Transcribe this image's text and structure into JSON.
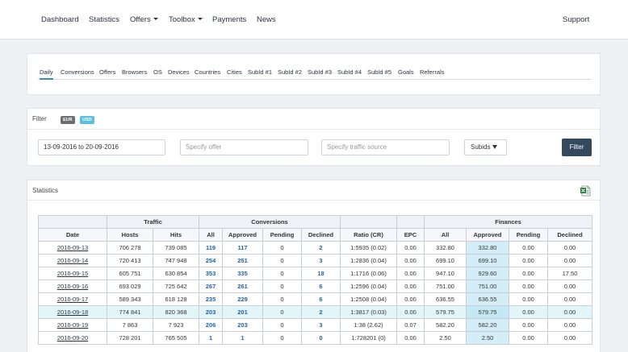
{
  "nav": {
    "items": [
      {
        "label": "Dashboard",
        "dropdown": false
      },
      {
        "label": "Statistics",
        "dropdown": false
      },
      {
        "label": "Offers",
        "dropdown": true
      },
      {
        "label": "Toolbox",
        "dropdown": true
      },
      {
        "label": "Payments",
        "dropdown": false
      },
      {
        "label": "News",
        "dropdown": false
      }
    ],
    "support": "Support"
  },
  "tabs": [
    "Daily",
    "Conversions",
    "Offers",
    "Browsers",
    "OS",
    "Devices",
    "Countries",
    "Cities",
    "SubId #1",
    "SubId #2",
    "SubId #3",
    "SubId #4",
    "SubId #5",
    "Goals",
    "Referrals"
  ],
  "active_tab": "Daily",
  "filter": {
    "title": "Filter",
    "currencies": [
      "EUR",
      "USD"
    ],
    "active_currency": "USD",
    "date_range": "13-09-2016 to 20-09-2016",
    "offer_placeholder": "Specify offer",
    "source_placeholder": "Specify traffic source",
    "subids_label": "Subids",
    "button_label": "Filter"
  },
  "stats": {
    "title": "Statistics",
    "groups": {
      "traffic": "Traffic",
      "conversions": "Conversions",
      "finances": "Finances"
    },
    "columns": [
      "Date",
      "Hosts",
      "Hits",
      "All",
      "Approved",
      "Pending",
      "Declined",
      "Ratio (CR)",
      "EPC",
      "All",
      "Approved",
      "Pending",
      "Declined"
    ],
    "rows": [
      {
        "date": "2016-09-13",
        "hosts": "706 278",
        "hits": "739 085",
        "conv_all": "119",
        "conv_approved": "117",
        "conv_pending": "0",
        "conv_declined": "2",
        "ratio": "1:5935 (0.02)",
        "epc": "0.00",
        "fin_all": "332.80",
        "fin_approved": "332.80",
        "fin_pending": "0.00",
        "fin_declined": "0.00",
        "highlight": false
      },
      {
        "date": "2016-09-14",
        "hosts": "720 413",
        "hits": "747 948",
        "conv_all": "254",
        "conv_approved": "251",
        "conv_pending": "0",
        "conv_declined": "3",
        "ratio": "1:2836 (0.04)",
        "epc": "0.00",
        "fin_all": "699.10",
        "fin_approved": "699.10",
        "fin_pending": "0.00",
        "fin_declined": "0.00",
        "highlight": false
      },
      {
        "date": "2016-09-15",
        "hosts": "605 751",
        "hits": "630 854",
        "conv_all": "353",
        "conv_approved": "335",
        "conv_pending": "0",
        "conv_declined": "18",
        "ratio": "1:1716 (0.06)",
        "epc": "0.00",
        "fin_all": "947.10",
        "fin_approved": "929.60",
        "fin_pending": "0.00",
        "fin_declined": "17.50",
        "highlight": false
      },
      {
        "date": "2016-09-16",
        "hosts": "693 029",
        "hits": "725 642",
        "conv_all": "267",
        "conv_approved": "261",
        "conv_pending": "0",
        "conv_declined": "6",
        "ratio": "1:2596 (0.04)",
        "epc": "0.00",
        "fin_all": "751.00",
        "fin_approved": "751.00",
        "fin_pending": "0.00",
        "fin_declined": "0.00",
        "highlight": false
      },
      {
        "date": "2016-09-17",
        "hosts": "589 343",
        "hits": "618 128",
        "conv_all": "235",
        "conv_approved": "229",
        "conv_pending": "0",
        "conv_declined": "6",
        "ratio": "1:2508 (0.04)",
        "epc": "0.00",
        "fin_all": "636.55",
        "fin_approved": "636.55",
        "fin_pending": "0.00",
        "fin_declined": "0.00",
        "highlight": false
      },
      {
        "date": "2016-09-18",
        "hosts": "774 841",
        "hits": "820 368",
        "conv_all": "203",
        "conv_approved": "201",
        "conv_pending": "0",
        "conv_declined": "2",
        "ratio": "1:3817 (0.03)",
        "epc": "0.00",
        "fin_all": "579.75",
        "fin_approved": "579.75",
        "fin_pending": "0.00",
        "fin_declined": "0.00",
        "highlight": true
      },
      {
        "date": "2016-09-19",
        "hosts": "7 863",
        "hits": "7 923",
        "conv_all": "206",
        "conv_approved": "203",
        "conv_pending": "0",
        "conv_declined": "3",
        "ratio": "1:38 (2.62)",
        "epc": "0.07",
        "fin_all": "582.20",
        "fin_approved": "582.20",
        "fin_pending": "0.00",
        "fin_declined": "0.00",
        "highlight": false
      },
      {
        "date": "2016-09-20",
        "hosts": "728 201",
        "hits": "765 505",
        "conv_all": "1",
        "conv_approved": "1",
        "conv_pending": "0",
        "conv_declined": "0",
        "ratio": "1:728201 (0)",
        "epc": "0.00",
        "fin_all": "2.50",
        "fin_approved": "2.50",
        "fin_pending": "0.00",
        "fin_declined": "0.00",
        "highlight": false
      }
    ]
  },
  "colors": {
    "accent": "#3a87c9",
    "button": "#34495e",
    "usd_badge": "#5bc0de",
    "eur_badge": "#6b6f74",
    "highlight_row": "#e2f5f9",
    "approved_cell": "#d4eef8",
    "link_number": "#2462a8"
  }
}
